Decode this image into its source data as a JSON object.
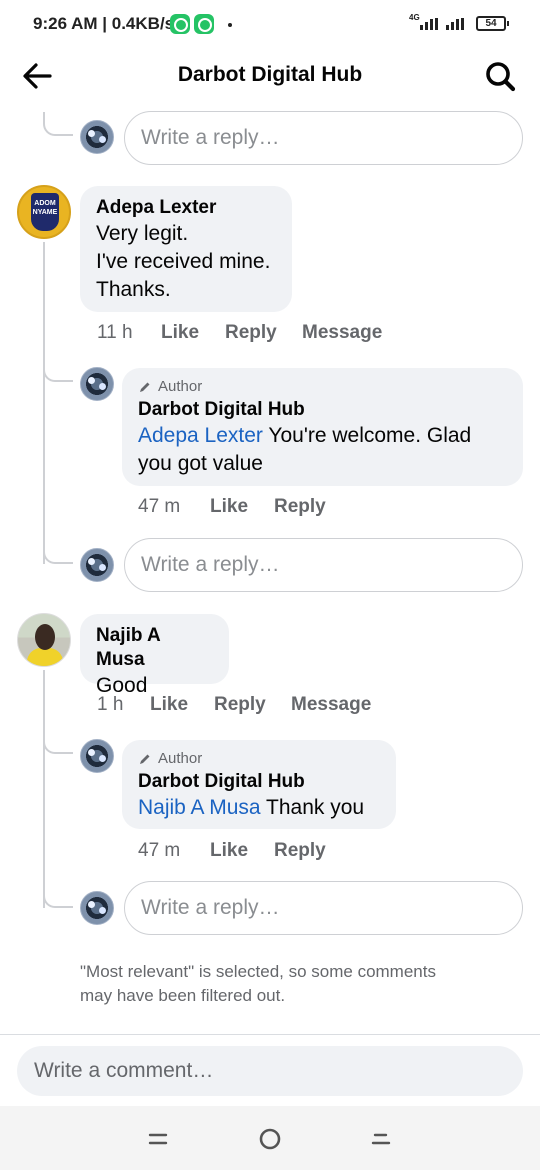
{
  "status_bar": {
    "time_speed": "9:26 AM | 0.4KB/s",
    "network": "4G",
    "battery": "54",
    "battery_level": 0.54
  },
  "header": {
    "title": "Darbot Digital Hub",
    "back_icon": "back-arrow-icon",
    "search_icon": "search-icon"
  },
  "reply_placeholder": "Write a reply…",
  "comments": [
    {
      "author": "Adepa Lexter",
      "avatar_text": [
        "ADOM",
        "NYAME"
      ],
      "lines": [
        "Very legit.",
        "I've received mine.",
        "Thanks."
      ],
      "time": "11 h",
      "like": "Like",
      "reply": "Reply",
      "message": "Message",
      "author_reply": {
        "badge": "Author",
        "name": "Darbot Digital Hub",
        "mention": "Adepa Lexter",
        "text_line1": " You're welcome. Glad",
        "text_line2": "you got value",
        "time": "47 m",
        "like": "Like",
        "reply": "Reply"
      }
    },
    {
      "author": "Najib A Musa",
      "lines": [
        "Good"
      ],
      "time": "1 h",
      "like": "Like",
      "reply": "Reply",
      "message": "Message",
      "author_reply": {
        "badge": "Author",
        "name": "Darbot Digital Hub",
        "mention": "Najib A Musa",
        "text_line1": " Thank you",
        "time": "47 m",
        "like": "Like",
        "reply": "Reply"
      }
    }
  ],
  "filter_note": "\"Most relevant\" is selected, so some comments may have been filtered out.",
  "comment_placeholder": "Write a comment…",
  "nav": {
    "recents_icon": "recent-apps-icon",
    "home_icon": "home-icon",
    "back_icon": "nav-back-icon"
  }
}
